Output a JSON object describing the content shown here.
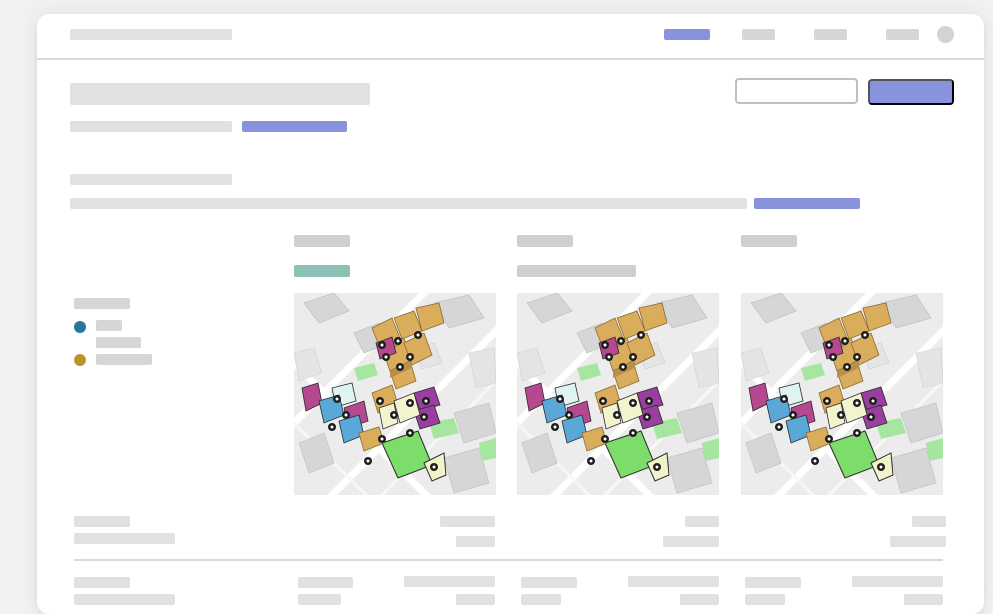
{
  "colors": {
    "accent": "#8993dd",
    "success_tag": "#8ec1b5",
    "legend_series_1": "#26779c",
    "legend_series_2": "#c0922e"
  },
  "header": {
    "logo_text": "",
    "nav_items": [
      "",
      "",
      "",
      ""
    ],
    "avatar_icon": "avatar-icon"
  },
  "page": {
    "title": "",
    "subtitle": "",
    "subtitle_link": "",
    "secondary_button": "",
    "primary_button": ""
  },
  "section": {
    "heading": "",
    "description": "",
    "description_link": ""
  },
  "legend": {
    "title": "",
    "items": [
      {
        "label": "",
        "label_line2": "",
        "color": "#26779c"
      },
      {
        "label": "",
        "color": "#c0922e"
      }
    ]
  },
  "variants": [
    {
      "name": "",
      "tag": "",
      "map_icon": "isometric-city-map"
    },
    {
      "name": "",
      "tag": "",
      "map_icon": "isometric-city-map"
    },
    {
      "name": "",
      "tag": "",
      "map_icon": "isometric-city-map"
    }
  ],
  "table": {
    "rows": [
      {
        "label": "",
        "sublabel": "",
        "values": [
          "",
          "",
          ""
        ],
        "subvalues": [
          "",
          "",
          ""
        ]
      },
      {
        "label": "",
        "sublabel": "",
        "values": [
          "",
          "",
          ""
        ],
        "subvalues": [
          "",
          "",
          ""
        ]
      }
    ]
  }
}
